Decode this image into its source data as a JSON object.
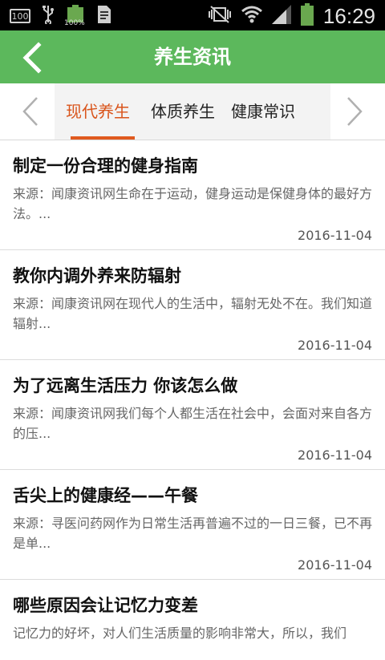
{
  "status_bar": {
    "icons_left": [
      "battery-100-box",
      "usb-icon",
      "battery-100-icon",
      "document-icon"
    ],
    "battery_label": "100%",
    "box_label": "100",
    "icons_right": [
      "mute-vibrate-icon",
      "wifi-icon",
      "signal-icon",
      "battery-icon"
    ],
    "time": "16:29"
  },
  "header": {
    "title": "养生资讯",
    "color": "#5cb85c"
  },
  "tabs": {
    "items": [
      {
        "label": "现代养生",
        "active": true
      },
      {
        "label": "体质养生",
        "active": false
      },
      {
        "label": "健康常识",
        "active": false
      }
    ],
    "active_color": "#d9541b"
  },
  "articles": [
    {
      "title": "制定一份合理的健身指南",
      "summary": "来源：闻康资讯网生命在于运动，健身运动是保健身体的最好方法。...",
      "date": "2016-11-04"
    },
    {
      "title": "教你内调外养来防辐射",
      "summary": "来源：闻康资讯网在现代人的生活中，辐射无处不在。我们知道辐射...",
      "date": "2016-11-04"
    },
    {
      "title": "为了远离生活压力 你该怎么做",
      "summary": "来源：闻康资讯网我们每个人都生活在社会中，会面对来自各方的压...",
      "date": "2016-11-04"
    },
    {
      "title": "舌尖上的健康经——午餐",
      "summary": "来源：寻医问药网作为日常生活再普遍不过的一日三餐，已不再是单...",
      "date": "2016-11-04"
    },
    {
      "title": "哪些原因会让记忆力变差",
      "summary": "记忆力的好坏，对人们生活质量的影响非常大，所以，我们",
      "date": ""
    }
  ]
}
